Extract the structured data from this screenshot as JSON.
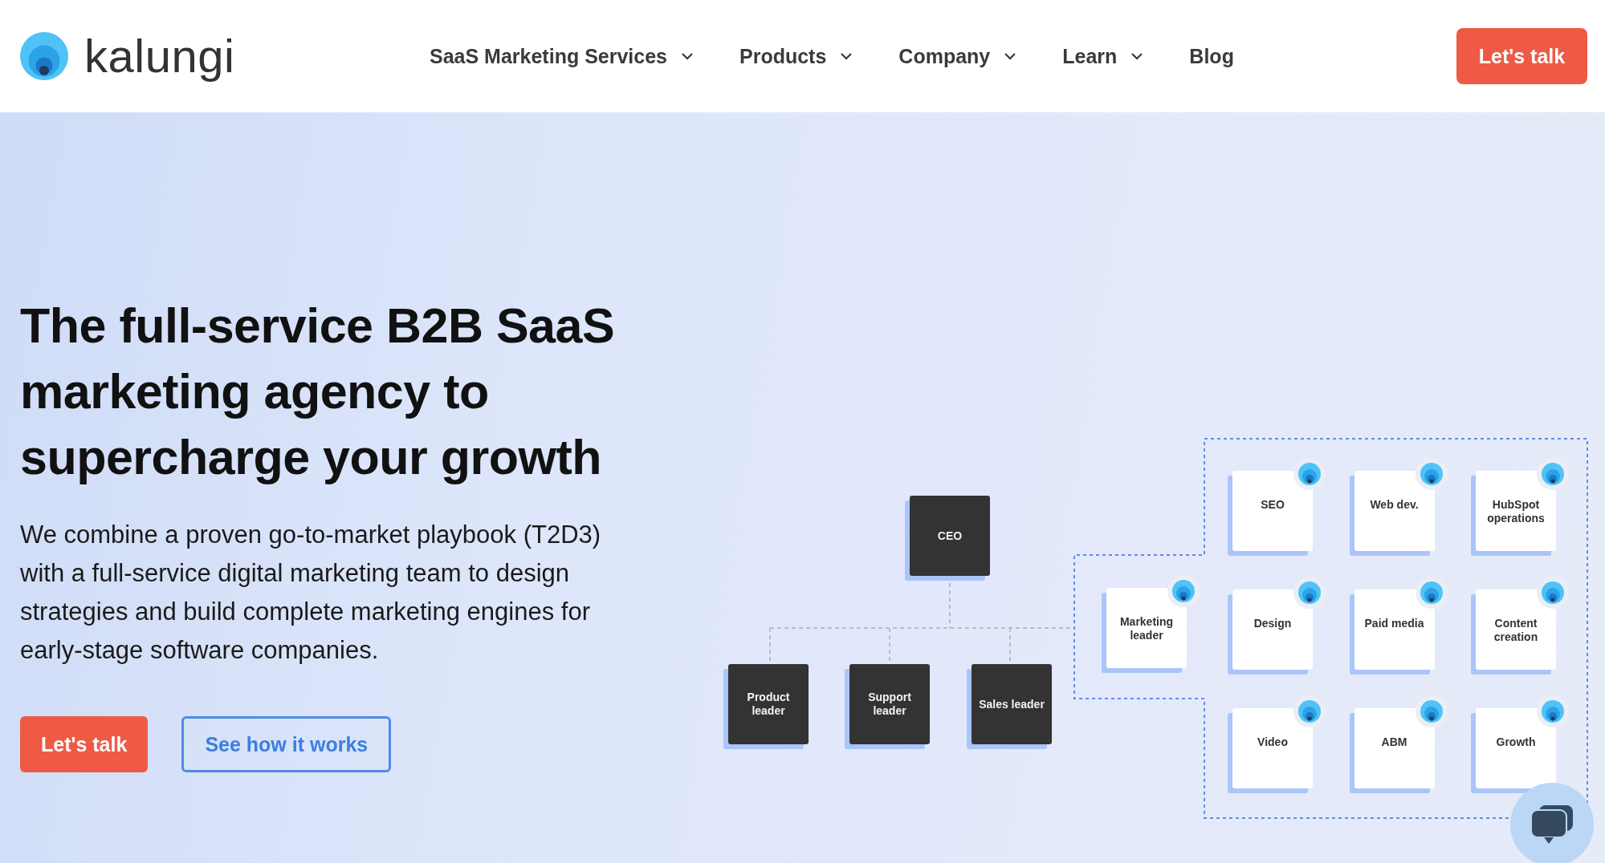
{
  "nav": {
    "logo": "kalungi",
    "items": [
      {
        "label": "SaaS Marketing Services",
        "dropdown": true
      },
      {
        "label": "Products",
        "dropdown": true
      },
      {
        "label": "Company",
        "dropdown": true
      },
      {
        "label": "Learn",
        "dropdown": true
      },
      {
        "label": "Blog",
        "dropdown": false
      }
    ],
    "cta": "Let's talk"
  },
  "hero": {
    "heading": "The full-service B2B SaaS marketing agency to supercharge your growth",
    "body": "We combine a proven go-to-market playbook (T2D3) with a full-service digital marketing team to design strategies and build complete marketing engines for early-stage software companies.",
    "buttons": [
      {
        "label": "Let's talk",
        "kind": "primary"
      },
      {
        "label": "See how it works",
        "kind": "outline"
      }
    ]
  },
  "org_chart": {
    "ceo": "CEO",
    "leaders": [
      "Product leader",
      "Support leader",
      "Sales leader"
    ],
    "marketing_leader": "Marketing leader",
    "team": [
      "SEO",
      "Web dev.",
      "HubSpot operations",
      "Design",
      "Paid media",
      "Content creation",
      "Video",
      "ABM",
      "Growth"
    ]
  }
}
